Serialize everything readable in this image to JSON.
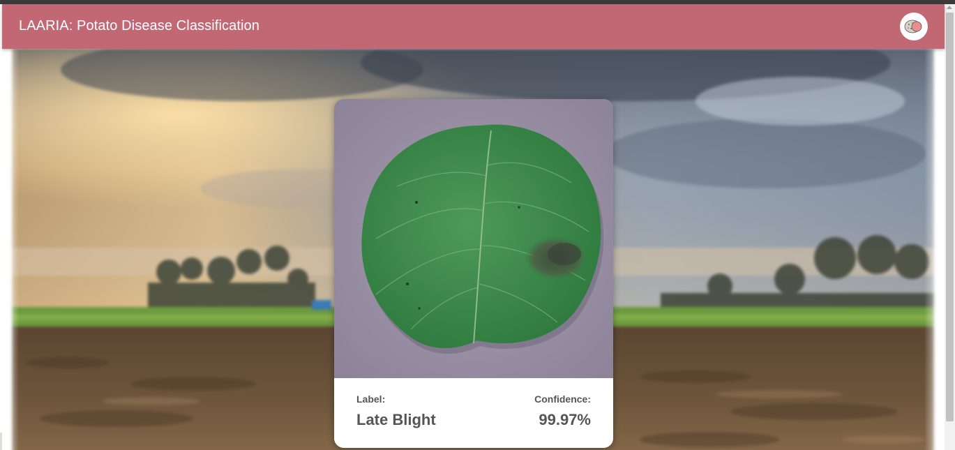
{
  "app_bar": {
    "title": "LAARIA: Potato Disease Classification",
    "background_color": "#c26875",
    "logo_icon": "potato-logo-icon"
  },
  "background": {
    "description_icon": "farm-field-background-image"
  },
  "result_card": {
    "image_icon": "potato-leaf-image",
    "label_heading": "Label:",
    "label_value": "Late Blight",
    "confidence_heading": "Confidence:",
    "confidence_value": "99.97%"
  },
  "colors": {
    "text_muted": "#555555",
    "card_bg": "#ffffff"
  }
}
